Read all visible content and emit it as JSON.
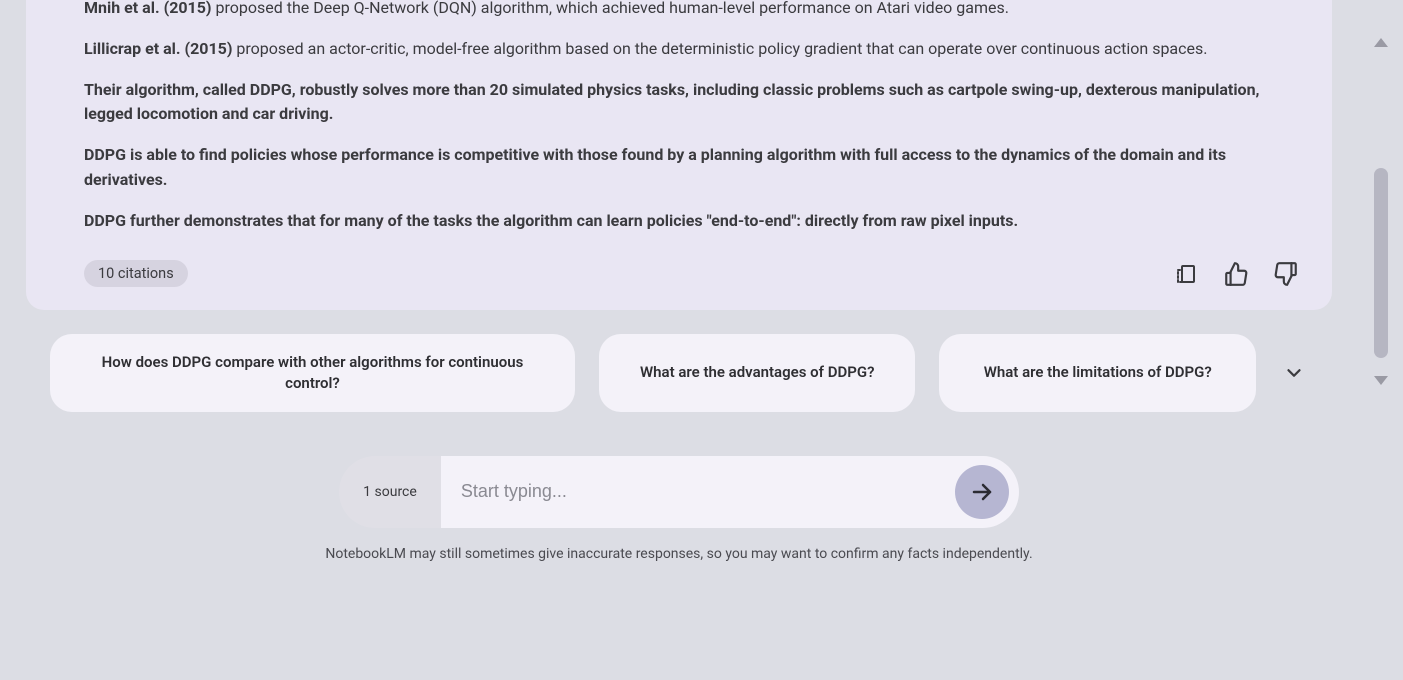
{
  "response": {
    "paragraphs": [
      {
        "lead": "Mnih et al. (2015)",
        "rest": " proposed the Deep Q-Network (DQN) algorithm, which achieved human-level performance on Atari video games.",
        "bold_all": false
      },
      {
        "lead": "Lillicrap et al. (2015)",
        "rest": " proposed an actor-critic, model-free algorithm based on the deterministic policy gradient that can operate over continuous action spaces.",
        "bold_all": false
      },
      {
        "lead": "",
        "rest": "Their algorithm, called DDPG, robustly solves more than 20 simulated physics tasks, including classic problems such as cartpole swing-up, dexterous manipulation, legged locomotion and car driving.",
        "bold_all": true
      },
      {
        "lead": "",
        "rest": "DDPG is able to find policies whose performance is competitive with those found by a planning algorithm with full access to the dynamics of the domain and its derivatives.",
        "bold_all": true
      },
      {
        "lead": "",
        "rest": "DDPG further demonstrates that for many of the tasks the algorithm can learn policies \"end-to-end\": directly from raw pixel inputs.",
        "bold_all": true
      }
    ],
    "citations_label": "10 citations"
  },
  "suggestions": [
    "How does DDPG compare with other algorithms for continuous control?",
    "What are the advantages of DDPG?",
    "What are the limitations of DDPG?"
  ],
  "input": {
    "source_count_label": "1 source",
    "placeholder": "Start typing..."
  },
  "disclaimer": "NotebookLM may still sometimes give inaccurate responses, so you may want to confirm any facts independently."
}
